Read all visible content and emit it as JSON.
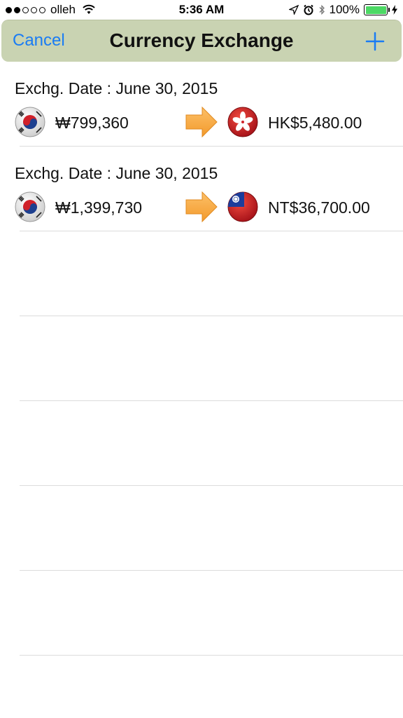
{
  "status": {
    "carrier": "olleh",
    "time": "5:36 AM",
    "battery": "100%",
    "signal_dots_filled": 2,
    "signal_dots_total": 5
  },
  "nav": {
    "cancel_label": "Cancel",
    "title": "Currency Exchange",
    "add_icon": "plus-icon"
  },
  "exchanges": [
    {
      "date": "Exchg. Date : June 30, 2015",
      "from_flag": "south-korea-flag-icon",
      "from_amount": "₩799,360",
      "to_flag": "hong-kong-flag-icon",
      "to_amount": "HK$5,480.00"
    },
    {
      "date": "Exchg. Date : June 30, 2015",
      "from_flag": "south-korea-flag-icon",
      "from_amount": "₩1,399,730",
      "to_flag": "taiwan-flag-icon",
      "to_amount": "NT$36,700.00"
    }
  ],
  "colors": {
    "nav_background": "#c9d3b2",
    "accent": "#1a7cf4",
    "arrow": "#f6a93b",
    "battery": "#4cd964"
  }
}
